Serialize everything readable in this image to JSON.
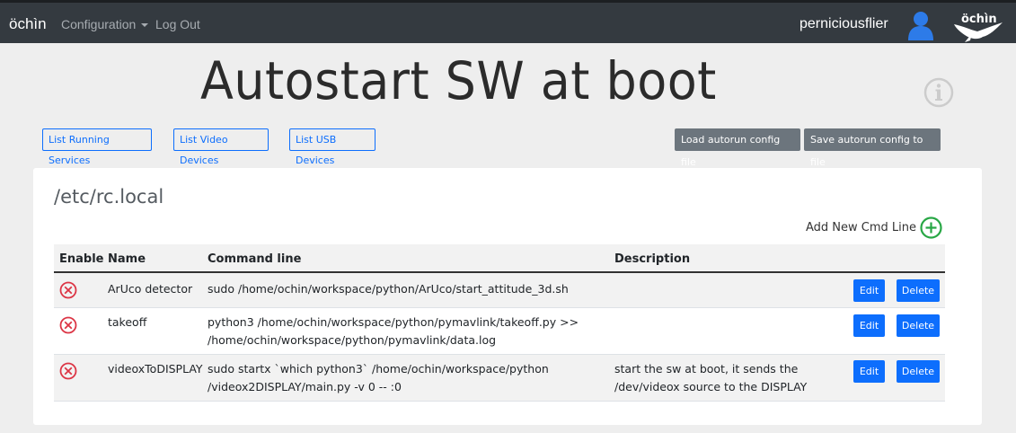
{
  "navbar": {
    "brand": "öchìn",
    "configuration": "Configuration",
    "logout": "Log Out",
    "username": "perniciousflier",
    "logo_text": "öchìn"
  },
  "page": {
    "title": "Autostart SW at boot"
  },
  "toolbar": {
    "list_running_services": "List Running Services",
    "list_video_devices": "List Video Devices",
    "list_usb_devices": "List USB Devices",
    "load_config": "Load autorun config file",
    "save_config": "Save autorun config to file"
  },
  "card": {
    "title": "/etc/rc.local",
    "add_label": "Add New Cmd Line"
  },
  "table": {
    "headers": [
      "Enable",
      "Name",
      "Command line",
      "Description"
    ],
    "edit_label": "Edit",
    "delete_label": "Delete",
    "rows": [
      {
        "name": "ArUco detector",
        "command": [
          "sudo /home/ochin/workspace/python/ArUco/start_attitude_3d.sh"
        ],
        "description": []
      },
      {
        "name": "takeoff",
        "command": [
          "python3 /home/ochin/workspace/python/pymavlink/takeoff.py >>",
          "/home/ochin/workspace/python/pymavlink/data.log"
        ],
        "description": []
      },
      {
        "name": "videoxToDISPLAY",
        "command": [
          "sudo startx `which python3` /home/ochin/workspace/python",
          "/videox2DISPLAY/main.py -v 0 -- :0"
        ],
        "description": [
          "start the sw at boot, it sends the",
          "/dev/videox source to the DISPLAY"
        ]
      }
    ]
  },
  "colors": {
    "navbar": "#343a40",
    "primary": "#0d6efd",
    "secondary": "#6c757d",
    "disabled_red": "#dc3545",
    "add_green": "#28a745"
  }
}
